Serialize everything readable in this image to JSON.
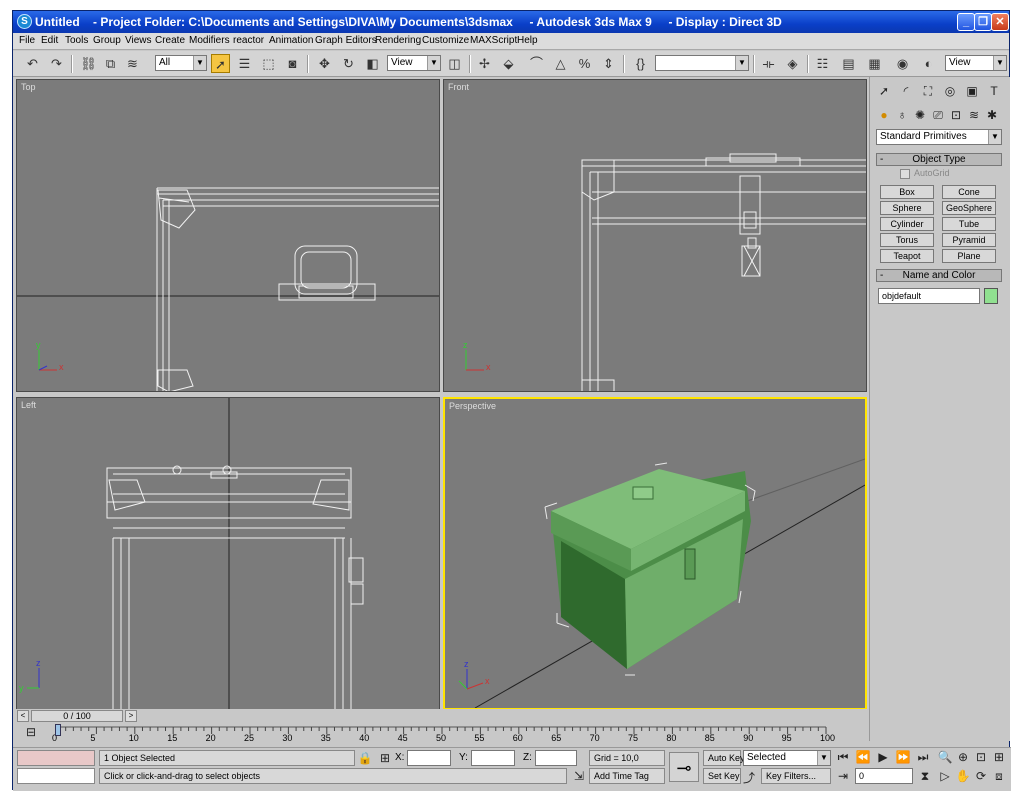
{
  "window": {
    "title": "Untitled    - Project Folder: C:\\Documents and Settings\\DIVA\\My Documents\\3dsmax     - Autodesk 3ds Max 9     - Display : Direct 3D",
    "minimize": "_",
    "maximize": "❐",
    "close": "✕"
  },
  "menu": [
    "File",
    "Edit",
    "Tools",
    "Group",
    "Views",
    "Create",
    "Modifiers",
    "reactor",
    "Animation",
    "Graph Editors",
    "Rendering",
    "Customize",
    "MAXScript",
    "Help"
  ],
  "toolbar": {
    "selection_filter": "All",
    "ref_coord": "View",
    "named_selection": "",
    "view_dropdown": "View"
  },
  "viewports": {
    "top": "Top",
    "front": "Front",
    "left": "Left",
    "perspective": "Perspective",
    "axis_x": "x",
    "axis_y": "y",
    "axis_z": "z"
  },
  "command_panel": {
    "category": "Standard Primitives",
    "object_type_title": "Object Type",
    "autogrid": "AutoGrid",
    "buttons": [
      "Box",
      "Cone",
      "Sphere",
      "GeoSphere",
      "Cylinder",
      "Tube",
      "Torus",
      "Pyramid",
      "Teapot",
      "Plane"
    ],
    "name_color_title": "Name and Color",
    "object_name": "objdefault",
    "object_color": "#90e090",
    "rollout_toggle": "-"
  },
  "timeline": {
    "frame_label": "0 / 100",
    "ticks": [
      "0",
      "5",
      "10",
      "15",
      "20",
      "25",
      "30",
      "35",
      "40",
      "45",
      "50",
      "55",
      "60",
      "65",
      "70",
      "75",
      "80",
      "85",
      "90",
      "95",
      "100"
    ],
    "prev": "<",
    "next": ">"
  },
  "status": {
    "selection": "1 Object Selected",
    "prompt": "Click or click-and-drag to select objects",
    "x_label": "X:",
    "y_label": "Y:",
    "z_label": "Z:",
    "x_value": "",
    "y_value": "",
    "z_value": "",
    "grid": "Grid = 10,0",
    "add_time_tag": "Add Time Tag",
    "auto_key": "Auto Key",
    "set_key": "Set Key",
    "key_mode": "Selected",
    "key_filters": "Key Filters...",
    "current_frame": "0"
  },
  "colors": {
    "viewport_bg": "#7b7b7b",
    "active_viewport_border": "#ffe400",
    "chest_green": "#6fae6a",
    "wireframe": "#ffffff"
  }
}
